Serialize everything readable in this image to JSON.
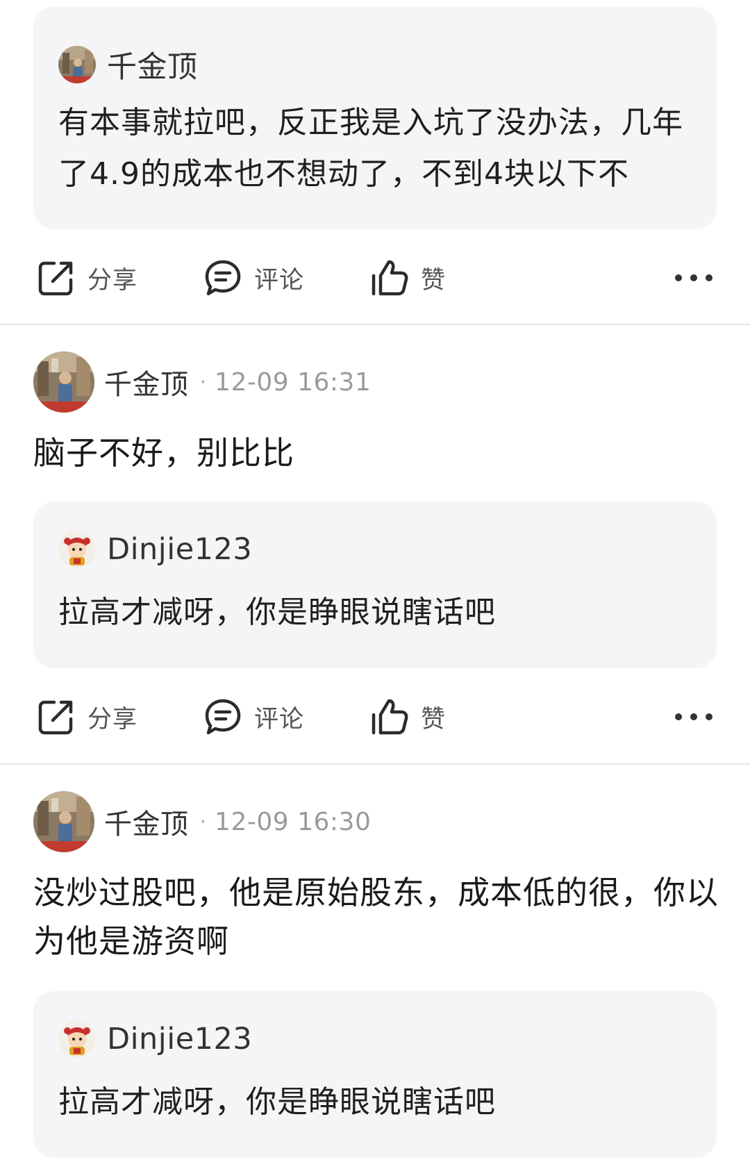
{
  "top_quote": {
    "user": "千金顶",
    "text": "有本事就拉吧，反正我是入坑了没办法，几年了4.9的成本也不想动了，不到4块以下不"
  },
  "actions": {
    "share": "分享",
    "comment": "评论",
    "like": "赞"
  },
  "posts": [
    {
      "user": "千金顶",
      "time": "12-09 16:31",
      "text": "脑子不好，别比比",
      "quote": {
        "user": "Dinjie123",
        "text": "拉高才减呀，你是睁眼说瞎话吧"
      }
    },
    {
      "user": "千金顶",
      "time": "12-09 16:30",
      "text": "没炒过股吧，他是原始股东，成本低的很，你以为他是游资啊",
      "quote": {
        "user": "Dinjie123",
        "text": "拉高才减呀，你是睁眼说瞎话吧"
      }
    }
  ],
  "colors": {
    "quote_bg": "#f5f5f7",
    "text": "#1f1f1f",
    "time": "#9a9a9a",
    "divider": "#e6e6e6"
  },
  "icons": [
    "share-icon",
    "comment-icon",
    "like-icon",
    "more-icon",
    "avatar-photo",
    "avatar-mascot"
  ]
}
